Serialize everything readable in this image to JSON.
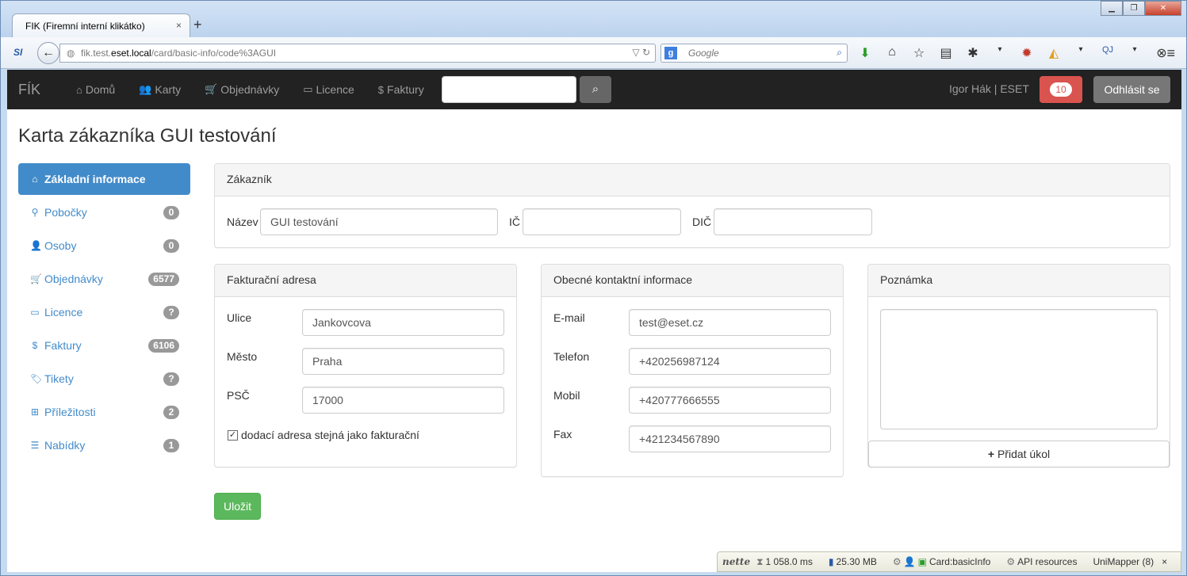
{
  "browser": {
    "tab_title": "FIK (Firemní interní klikátko)",
    "tab_close": "×",
    "new_tab": "+",
    "url_prefix": "fik.test.",
    "url_host": "eset.local",
    "url_path": "/card/basic-info/code%3AGUI",
    "search_placeholder": "Google"
  },
  "app": {
    "brand": "FÍK",
    "nav": [
      {
        "label": "Domů",
        "icon": "home-icon",
        "glyph": "⌂"
      },
      {
        "label": "Karty",
        "icon": "users-icon",
        "glyph": "👥"
      },
      {
        "label": "Objednávky",
        "icon": "shopping-cart-icon",
        "glyph": "🛒"
      },
      {
        "label": "Licence",
        "icon": "laptop-icon",
        "glyph": "▭"
      },
      {
        "label": "Faktury",
        "icon": "dollar-icon",
        "glyph": "$"
      }
    ],
    "user": "Igor Hák | ESET",
    "notifications": "10",
    "logout": "Odhlásit se"
  },
  "page": {
    "title": "Karta zákazníka GUI testování"
  },
  "sidebar": {
    "items": [
      {
        "label": "Základní informace",
        "badge": "",
        "icon": "home-icon",
        "glyph": "⌂"
      },
      {
        "label": "Pobočky",
        "badge": "0",
        "icon": "map-marker-icon",
        "glyph": "⚲"
      },
      {
        "label": "Osoby",
        "badge": "0",
        "icon": "user-icon",
        "glyph": "👤"
      },
      {
        "label": "Objednávky",
        "badge": "6577",
        "icon": "shopping-cart-icon",
        "glyph": "🛒"
      },
      {
        "label": "Licence",
        "badge": "?",
        "icon": "laptop-icon",
        "glyph": "▭"
      },
      {
        "label": "Faktury",
        "badge": "6106",
        "icon": "dollar-icon",
        "glyph": "$"
      },
      {
        "label": "Tikety",
        "badge": "?",
        "icon": "tags-icon",
        "glyph": "🏷"
      },
      {
        "label": "Příležitosti",
        "badge": "2",
        "icon": "sitemap-icon",
        "glyph": "⊞"
      },
      {
        "label": "Nabídky",
        "badge": "1",
        "icon": "list-icon",
        "glyph": "☰"
      }
    ]
  },
  "customer": {
    "heading": "Zákazník",
    "name_label": "Název",
    "name_value": "GUI testování",
    "ic_label": "IČ",
    "ic_value": "",
    "dic_label": "DIČ",
    "dic_value": ""
  },
  "billing": {
    "heading": "Fakturační adresa",
    "street_label": "Ulice",
    "street_value": "Jankovcova",
    "city_label": "Město",
    "city_value": "Praha",
    "zip_label": "PSČ",
    "zip_value": "17000",
    "same_address_label": "dodací adresa stejná jako fakturační",
    "same_address_checked": "✓"
  },
  "contact": {
    "heading": "Obecné kontaktní informace",
    "email_label": "E-mail",
    "email_value": "test@eset.cz",
    "phone_label": "Telefon",
    "phone_value": "+420256987124",
    "mobile_label": "Mobil",
    "mobile_value": "+420777666555",
    "fax_label": "Fax",
    "fax_value": "+421234567890"
  },
  "note": {
    "heading": "Poznámka",
    "value": "",
    "add_task": "Přidat úkol"
  },
  "actions": {
    "save": "Uložit"
  },
  "debugbar": {
    "logo": "nette",
    "time": "1 058.0 ms",
    "memory": "25.30 MB",
    "presenter": "Card:basicInfo",
    "api": "API resources",
    "mapper": "UniMapper (8)",
    "close": "×"
  },
  "colors": {
    "navbar_bg": "#222222",
    "primary": "#428bca",
    "danger": "#d9534f",
    "success": "#5cb85c",
    "badge": "#999999"
  }
}
